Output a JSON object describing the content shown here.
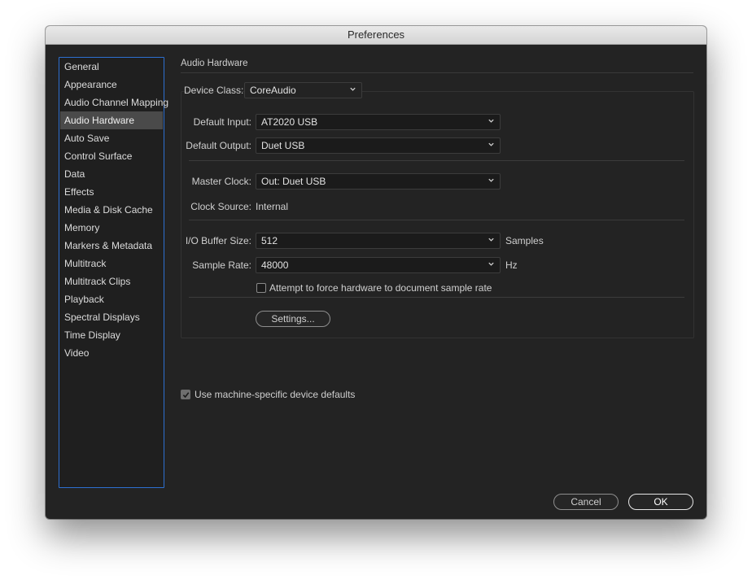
{
  "window": {
    "title": "Preferences"
  },
  "sidebar": {
    "selected_index": 3,
    "items": [
      {
        "label": "General"
      },
      {
        "label": "Appearance"
      },
      {
        "label": "Audio Channel Mapping"
      },
      {
        "label": "Audio Hardware"
      },
      {
        "label": "Auto Save"
      },
      {
        "label": "Control Surface"
      },
      {
        "label": "Data"
      },
      {
        "label": "Effects"
      },
      {
        "label": "Media & Disk Cache"
      },
      {
        "label": "Memory"
      },
      {
        "label": "Markers & Metadata"
      },
      {
        "label": "Multitrack"
      },
      {
        "label": "Multitrack Clips"
      },
      {
        "label": "Playback"
      },
      {
        "label": "Spectral Displays"
      },
      {
        "label": "Time Display"
      },
      {
        "label": "Video"
      }
    ]
  },
  "panel": {
    "section_title": "Audio Hardware",
    "device_class": {
      "label": "Device Class:",
      "value": "CoreAudio"
    },
    "default_input": {
      "label": "Default Input:",
      "value": "AT2020 USB"
    },
    "default_output": {
      "label": "Default Output:",
      "value": "Duet USB"
    },
    "master_clock": {
      "label": "Master Clock:",
      "value": "Out: Duet USB"
    },
    "clock_source": {
      "label": "Clock Source:",
      "value": "Internal"
    },
    "buffer_size": {
      "label": "I/O Buffer Size:",
      "value": "512",
      "unit": "Samples"
    },
    "sample_rate": {
      "label": "Sample Rate:",
      "value": "48000",
      "unit": "Hz"
    },
    "force_rate": {
      "label": "Attempt to force hardware to document sample rate",
      "checked": false
    },
    "settings_button": "Settings...",
    "machine_defaults": {
      "label": "Use machine-specific device defaults",
      "checked": true
    }
  },
  "footer": {
    "cancel": "Cancel",
    "ok": "OK"
  },
  "colors": {
    "window_bg": "#232323",
    "selection": "#4a4a4a",
    "focus_border": "#2d6fd0"
  }
}
